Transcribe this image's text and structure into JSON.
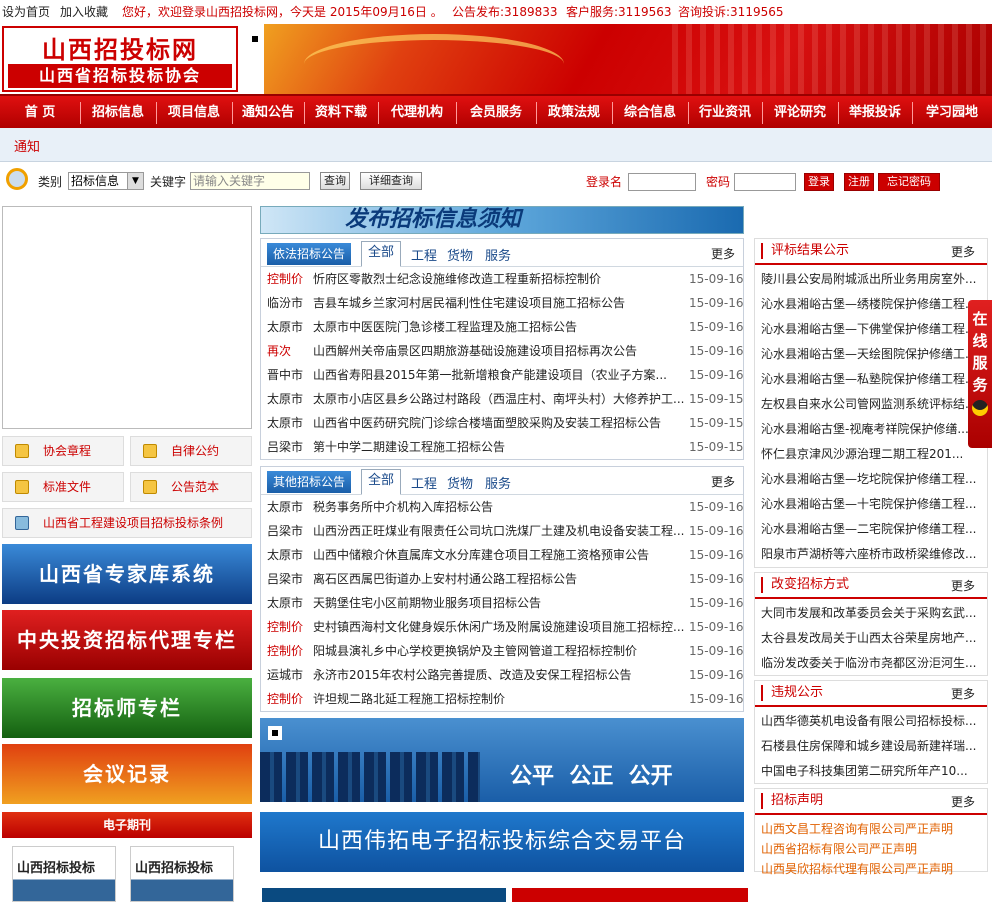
{
  "topbar": {
    "home": "设为首页",
    "fav": "加入收藏",
    "welcome": "您好，欢迎登录山西招投标网，今天是 2015年09月16日 。",
    "publish": "公告发布:3189833",
    "service": "客户服务:3119563",
    "complaint": "咨询投诉:3119565"
  },
  "logo": {
    "title": "山西招投标网",
    "subtitle": "山西省招标投标协会"
  },
  "nav": [
    "首 页",
    "招标信息",
    "项目信息",
    "通知公告",
    "资料下载",
    "代理机构",
    "会员服务",
    "政策法规",
    "综合信息",
    "行业资讯",
    "评论研究",
    "举报投诉",
    "学习园地"
  ],
  "notice": {
    "label": "通知"
  },
  "search": {
    "category_label": "类别",
    "category_value": "招标信息",
    "keyword_label": "关键字",
    "keyword_placeholder": "请输入关键字",
    "query": "查询",
    "advanced": "详细查询",
    "login_label": "登录名",
    "password_label": "密码",
    "login": "登录",
    "register": "注册",
    "forgot": "忘记密码"
  },
  "left": {
    "links": [
      "协会章程",
      "自律公约",
      "标准文件",
      "公告范本"
    ],
    "law": "山西省工程建设项目招标投标条例",
    "promos": [
      "山西省专家库系统",
      "中央投资招标代理专栏",
      "招标师专栏",
      "会议记录"
    ],
    "journal": "电子期刊",
    "journal_covers": [
      "山西招标投标",
      "山西招标投标"
    ]
  },
  "banner_publish": "发布招标信息须知",
  "panel1": {
    "title": "依法招标公告",
    "tabs": [
      "全部",
      "工程",
      "货物",
      "服务"
    ],
    "more": "更多",
    "rows": [
      {
        "tag": "控制价",
        "title": "忻府区零散烈士纪念设施维修改造工程重新招标控制价",
        "date": "15-09-16",
        "red": true
      },
      {
        "tag": "临汾市",
        "title": "吉县车城乡兰家河村居民福利性住宅建设项目施工招标公告",
        "date": "15-09-16",
        "red": false
      },
      {
        "tag": "太原市",
        "title": "太原市中医医院门急诊楼工程监理及施工招标公告",
        "date": "15-09-16",
        "red": false
      },
      {
        "tag": "再次",
        "title": "山西解州关帝庙景区四期旅游基础设施建设项目招标再次公告",
        "date": "15-09-16",
        "red": true
      },
      {
        "tag": "晋中市",
        "title": "山西省寿阳县2015年第一批新增粮食产能建设项目（农业子方案...",
        "date": "15-09-16",
        "red": false
      },
      {
        "tag": "太原市",
        "title": "太原市小店区县乡公路过村路段（西温庄村、南坪头村）大修养护工...",
        "date": "15-09-15",
        "red": false
      },
      {
        "tag": "太原市",
        "title": "山西省中医药研究院门诊综合楼墙面塑胶采购及安装工程招标公告",
        "date": "15-09-15",
        "red": false
      },
      {
        "tag": "吕梁市",
        "title": "第十中学二期建设工程施工招标公告",
        "date": "15-09-15",
        "red": false
      }
    ]
  },
  "panel2": {
    "title": "其他招标公告",
    "tabs": [
      "全部",
      "工程",
      "货物",
      "服务"
    ],
    "more": "更多",
    "rows": [
      {
        "tag": "太原市",
        "title": "税务事务所中介机构入库招标公告",
        "date": "15-09-16",
        "red": false
      },
      {
        "tag": "吕梁市",
        "title": "山西汾西正旺煤业有限责任公司坑口洗煤厂土建及机电设备安装工程...",
        "date": "15-09-16",
        "red": false
      },
      {
        "tag": "太原市",
        "title": "山西中储粮介休直属库文水分库建仓项目工程施工资格预审公告",
        "date": "15-09-16",
        "red": false
      },
      {
        "tag": "吕梁市",
        "title": "离石区西属巴街道办上安村村通公路工程招标公告",
        "date": "15-09-16",
        "red": false
      },
      {
        "tag": "太原市",
        "title": "天鹅堡住宅小区前期物业服务项目招标公告",
        "date": "15-09-16",
        "red": false
      },
      {
        "tag": "控制价",
        "title": "史村镇西海村文化健身娱乐休闲广场及附属设施建设项目施工招标控...",
        "date": "15-09-16",
        "red": true
      },
      {
        "tag": "控制价",
        "title": "阳城县演礼乡中心学校更换锅炉及主管网管道工程招标控制价",
        "date": "15-09-16",
        "red": true
      },
      {
        "tag": "运城市",
        "title": "永济市2015年农村公路完善提质、改造及安保工程招标公告",
        "date": "15-09-16",
        "red": false
      },
      {
        "tag": "控制价",
        "title": "许坦规二路北延工程施工招标控制价",
        "date": "15-09-16",
        "red": true
      }
    ]
  },
  "slogan": "公平  公正  公开",
  "platform": "山西伟拓电子招标投标综合交易平台",
  "right1": {
    "title": "评标结果公示",
    "more": "更多",
    "rows": [
      "陵川县公安局附城派出所业务用房室外...",
      "沁水县湘峪古堡—绣楼院保护修缮工程...",
      "沁水县湘峪古堡—下佛堂保护修缮工程...",
      "沁水县湘峪古堡—天绘图院保护修缮工...",
      "沁水县湘峪古堡—私塾院保护修缮工程...",
      "左权县自来水公司管网监测系统评标结...",
      "沁水县湘峪古堡-视庵考祥院保护修缮...",
      "怀仁县京津风沙源治理二期工程201...",
      "沁水县湘峪古堡—圪坨院保护修缮工程...",
      "沁水县湘峪古堡—十宅院保护修缮工程...",
      "沁水县湘峪古堡—二宅院保护修缮工程...",
      "阳泉市芦湖桥等六座桥市政桥梁维修改..."
    ]
  },
  "right2": {
    "title": "改变招标方式",
    "more": "更多",
    "rows": [
      "大同市发展和改革委员会关于采购玄武...",
      "太谷县发改局关于山西太谷荣星房地产...",
      "临汾发改委关于临汾市尧都区汾洰河生..."
    ]
  },
  "right3": {
    "title": "违规公示",
    "more": "更多",
    "rows": [
      "山西华德英机电设备有限公司招标投标...",
      "石楼县住房保障和城乡建设局新建祥瑞...",
      "中国电子科技集团第二研究所年产10..."
    ]
  },
  "right4": {
    "title": "招标声明",
    "more": "更多",
    "rows": [
      "山西文昌工程咨询有限公司严正声明",
      "山西省招标有限公司严正声明",
      "山西昊欣招标代理有限公司严正声明"
    ]
  },
  "float_service": "在线服务"
}
